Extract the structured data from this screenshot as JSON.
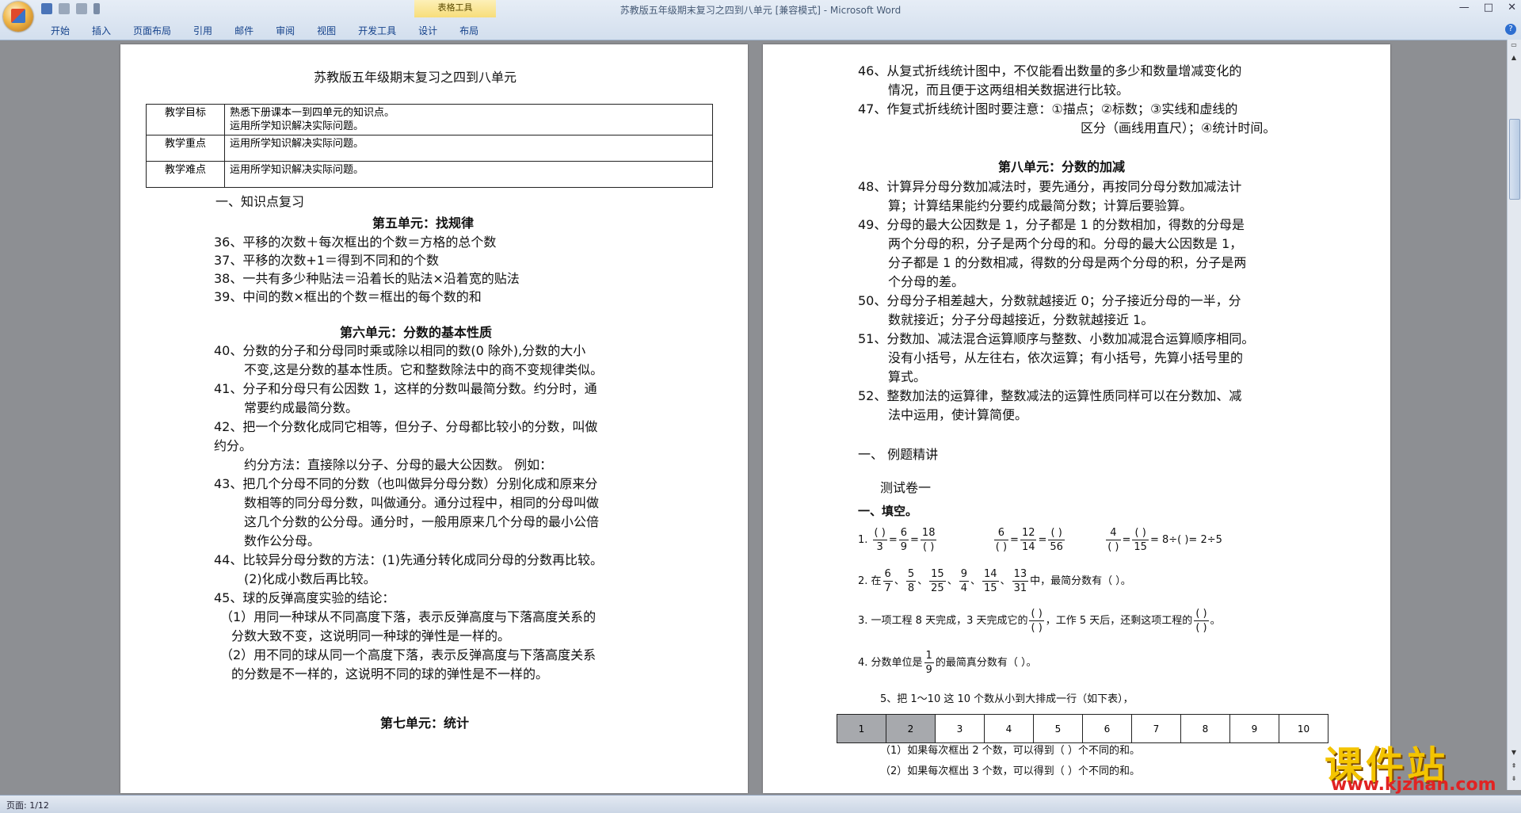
{
  "window": {
    "title": "苏教版五年级期末复习之四到八单元 [兼容模式] - Microsoft Word",
    "context_tab": "表格工具",
    "tabs": [
      "开始",
      "插入",
      "页面布局",
      "引用",
      "邮件",
      "审阅",
      "视图",
      "开发工具",
      "设计",
      "布局"
    ]
  },
  "status": {
    "page": "页面: 1/12"
  },
  "page1": {
    "title": "苏教版五年级期末复习之四到八单元",
    "table": [
      {
        "k": "教学目标",
        "v1": "熟悉下册课本一到四单元的知识点。",
        "v2": "运用所学知识解决实际问题。"
      },
      {
        "k": "教学重点",
        "v1": "运用所学知识解决实际问题。",
        "v2": ""
      },
      {
        "k": "教学难点",
        "v1": "运用所学知识解决实际问题。",
        "v2": ""
      }
    ],
    "section": "一、知识点复习",
    "unit5": "第五单元：找规律",
    "l36": "36、平移的次数＋每次框出的个数＝方格的总个数",
    "l37": "37、平移的次数+1＝得到不同和的个数",
    "l38": "38、一共有多少种贴法＝沿着长的贴法×沿着宽的贴法",
    "l39": "39、中间的数×框出的个数＝框出的每个数的和",
    "unit6": "第六单元：分数的基本性质",
    "l40a": "40、分数的分子和分母同时乘或除以相同的数(0 除外),分数的大小",
    "l40b": "不变,这是分数的基本性质。它和整数除法中的商不变规律类似。",
    "l41a": "41、分子和分母只有公因数 1，这样的分数叫最简分数。约分时，通",
    "l41b": "常要约成最简分数。",
    "l42a": "42、把一个分数化成同它相等，但分子、分母都比较小的分数，叫做",
    "l42b": "约分。",
    "l42c": "约分方法：直接除以分子、分母的最大公因数。 例如：",
    "l43a": "43、把几个分母不同的分数（也叫做异分母分数）分别化成和原来分",
    "l43b": "数相等的同分母分数，叫做通分。通分过程中，相同的分母叫做",
    "l43c": "这几个分数的公分母。通分时，一般用原来几个分母的最小公倍",
    "l43d": "数作公分母。",
    "l44a": "44、比较异分母分数的方法：(1)先通分转化成同分母的分数再比较。",
    "l44b": "(2)化成小数后再比较。",
    "l45": "45、球的反弹高度实验的结论：",
    "l45a": "（1）用同一种球从不同高度下落，表示反弹高度与下落高度关系的",
    "l45b": "分数大致不变，这说明同一种球的弹性是一样的。",
    "l45c": "（2）用不同的球从同一个高度下落，表示反弹高度与下落高度关系",
    "l45d": "的分数是不一样的，这说明不同的球的弹性是不一样的。",
    "unit7": "第七单元：统计"
  },
  "page2": {
    "l46a": "46、从复式折线统计图中，不仅能看出数量的多少和数量增减变化的",
    "l46b": "情况，而且便于这两组相关数据进行比较。",
    "l47a": "47、作复式折线统计图时要注意：①描点；②标数；③实线和虚线的",
    "l47b": "区分（画线用直尺）；④统计时间。",
    "unit8": "第八单元：分数的加减",
    "l48a": "48、计算异分母分数加减法时，要先通分，再按同分母分数加减法计",
    "l48b": "算；计算结果能约分要约成最简分数；计算后要验算。",
    "l49a": "49、分母的最大公因数是 1，分子都是 1 的分数相加，得数的分母是",
    "l49b": "两个分母的积，分子是两个分母的和。分母的最大公因数是 1，",
    "l49c": "分子都是 1 的分数相减，得数的分母是两个分母的积，分子是两",
    "l49d": "个分母的差。",
    "l50a": "50、分母分子相差越大，分数就越接近 0；分子接近分母的一半，分",
    "l50b": "数就接近；分子分母越接近，分数就越接近 1。",
    "l51a": "51、分数加、减法混合运算顺序与整数、小数加减混合运算顺序相同。",
    "l51b": "没有小括号，从左往右，依次运算；有小括号，先算小括号里的",
    "l51c": "算式。",
    "l52a": "52、整数加法的运算律，整数减法的运算性质同样可以在分数加、减",
    "l52b": "法中运用，使计算简便。",
    "sec": "一、   例题精讲",
    "test": "测试卷一",
    "fill": "一、填空。",
    "q1_no": "1.",
    "q1": {
      "a_n": "( )",
      "a_d": "3",
      "b_n": "6",
      "b_d": "9",
      "c_n": "18",
      "c_d": "( )",
      "d_n": "6",
      "d_d": "( )",
      "e_n": "12",
      "e_d": "14",
      "f_n": "( )",
      "f_d": "56",
      "g_n": "4",
      "g_d": "( )",
      "h_n": "( )",
      "h_d": "15",
      "tail": "= 8÷(    )= 2÷5"
    },
    "q2_pre": "2. 在",
    "q2_fracs": [
      [
        "6",
        "7"
      ],
      [
        "5",
        "8"
      ],
      [
        "15",
        "25"
      ],
      [
        "9",
        "4"
      ],
      [
        "14",
        "15"
      ],
      [
        "13",
        "31"
      ]
    ],
    "q2_post": "中，最简分数有（                          ）。",
    "q3_a": "3. 一项工程 8 天完成，3 天完成它的",
    "q3_b": "，工作 5 天后，还剩这项工程的",
    "q3_c": "。",
    "q4_a": "4. 分数单位是",
    "q4_n": "1",
    "q4_d": "9",
    "q4_b": "的最简真分数有（                          ）。",
    "q5": "5、把 1～10 这 10 个数从小到大排成一行（如下表），",
    "q5_cells": [
      "1",
      "2",
      "3",
      "4",
      "5",
      "6",
      "7",
      "8",
      "9",
      "10"
    ],
    "q5_1": "（1）如果每次框出 2 个数，可以得到（      ）个不同的和。",
    "q5_2": "（2）如果每次框出 3 个数，可以得到（      ）个不同的和。"
  },
  "watermark": {
    "main": "课件站",
    "url": "www.kjzhan.com"
  }
}
